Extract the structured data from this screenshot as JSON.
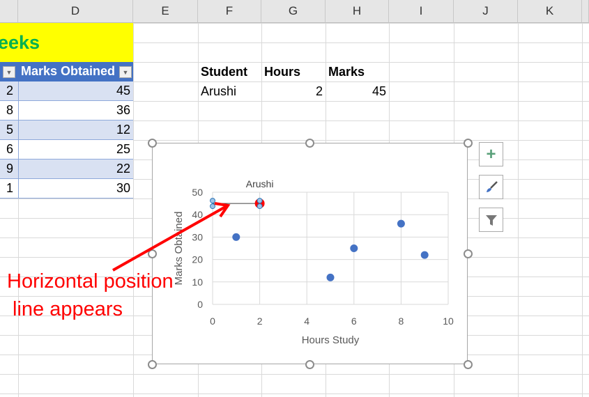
{
  "columns": [
    "D",
    "E",
    "F",
    "G",
    "H",
    "I",
    "J",
    "K"
  ],
  "title_text": "eeks",
  "table": {
    "headers": [
      "Marks Obtained"
    ],
    "rows": [
      {
        "hours": "2",
        "marks": "45"
      },
      {
        "hours": "8",
        "marks": "36"
      },
      {
        "hours": "5",
        "marks": "12"
      },
      {
        "hours": "6",
        "marks": "25"
      },
      {
        "hours": "9",
        "marks": "22"
      },
      {
        "hours": "1",
        "marks": "30"
      }
    ]
  },
  "lookup": {
    "headers": [
      "Student",
      "Hours",
      "Marks"
    ],
    "values": [
      "Arushi",
      "2",
      "45"
    ]
  },
  "chart_data": {
    "type": "scatter",
    "xlabel": "Hours Study",
    "ylabel": "Marks Obtained",
    "xlim": [
      0,
      10
    ],
    "ylim": [
      0,
      50
    ],
    "xticks": [
      "0",
      "2",
      "4",
      "6",
      "8",
      "10"
    ],
    "yticks": [
      "0",
      "10",
      "20",
      "30",
      "40",
      "50"
    ],
    "points": [
      {
        "x": 2,
        "y": 45
      },
      {
        "x": 8,
        "y": 36
      },
      {
        "x": 5,
        "y": 12
      },
      {
        "x": 6,
        "y": 25
      },
      {
        "x": 9,
        "y": 22
      },
      {
        "x": 1,
        "y": 30
      }
    ],
    "highlight": {
      "x": 2,
      "y": 45,
      "label": "Arushi",
      "color": "#ff0000"
    },
    "hline": {
      "y": 45,
      "x_from": 0,
      "x_to": 2
    },
    "point_color": "#4472c4",
    "grid": true
  },
  "side_buttons": [
    "chart-elements",
    "chart-styles",
    "chart-filters"
  ],
  "annotation": {
    "line1": "Horizontal position",
    "line2": "line appears",
    "color": "#ff0000"
  }
}
